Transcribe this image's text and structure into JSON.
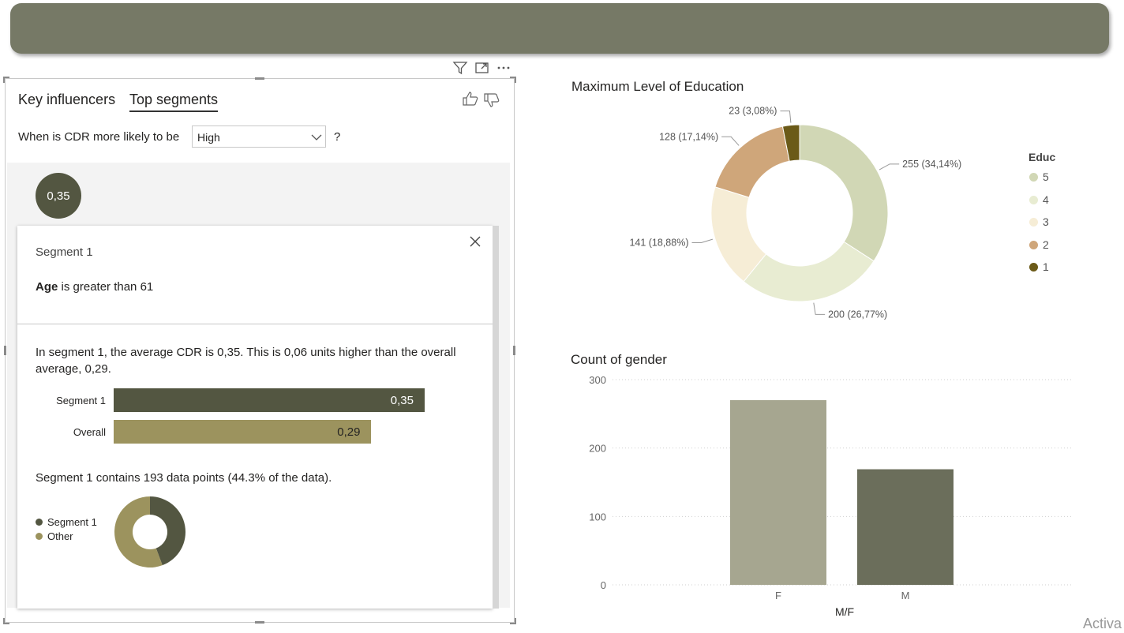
{
  "left_panel": {
    "tabs": [
      "Key influencers",
      "Top segments"
    ],
    "question_prefix": "When is CDR more likely to be",
    "dropdown_value": "High",
    "question_suffix": "?",
    "bubble_value": "0,35",
    "segment": {
      "title": "Segment 1",
      "condition_field": "Age",
      "condition_text": " is greater than 61",
      "summary": "In segment 1, the average CDR is 0,35. This is 0,06 units higher than the overall average, 0,29.",
      "bars": [
        {
          "label": "Segment 1",
          "value": 0.35,
          "display": "0,35",
          "color": "#535641"
        },
        {
          "label": "Overall",
          "value": 0.29,
          "display": "0,29",
          "color": "#9c935e"
        }
      ],
      "points_text": "Segment 1 contains 193 data points (44.3% of the data).",
      "donut_legend": [
        {
          "label": "Segment 1",
          "color": "#535641",
          "share": 0.443
        },
        {
          "label": "Other",
          "color": "#9c935e",
          "share": 0.557
        }
      ]
    }
  },
  "chart_data": [
    {
      "type": "pie",
      "title": "Maximum Level of Education",
      "legend_title": "Educ",
      "legend_position": "right",
      "slices": [
        {
          "label": "5",
          "value": 255,
          "data_label": "255 (34,14%)",
          "color": "#d1d7b5"
        },
        {
          "label": "4",
          "value": 200,
          "data_label": "200 (26,77%)",
          "color": "#e8ecd2"
        },
        {
          "label": "3",
          "value": 141,
          "data_label": "141 (18,88%)",
          "color": "#f6edd6"
        },
        {
          "label": "2",
          "value": 128,
          "data_label": "128 (17,14%)",
          "color": "#cfa67a"
        },
        {
          "label": "1",
          "value": 23,
          "data_label": "23 (3,08%)",
          "color": "#6b5a18"
        }
      ]
    },
    {
      "type": "bar",
      "title": "Count of gender",
      "xlabel": "M/F",
      "ylabel": "",
      "categories": [
        "F",
        "M"
      ],
      "values": [
        270,
        169
      ],
      "colors": [
        "#a6a690",
        "#6b6e5b"
      ],
      "ylim": [
        0,
        300
      ],
      "yticks": [
        "0",
        "100",
        "200",
        "300"
      ],
      "grid": true
    }
  ],
  "watermark": "Activa"
}
